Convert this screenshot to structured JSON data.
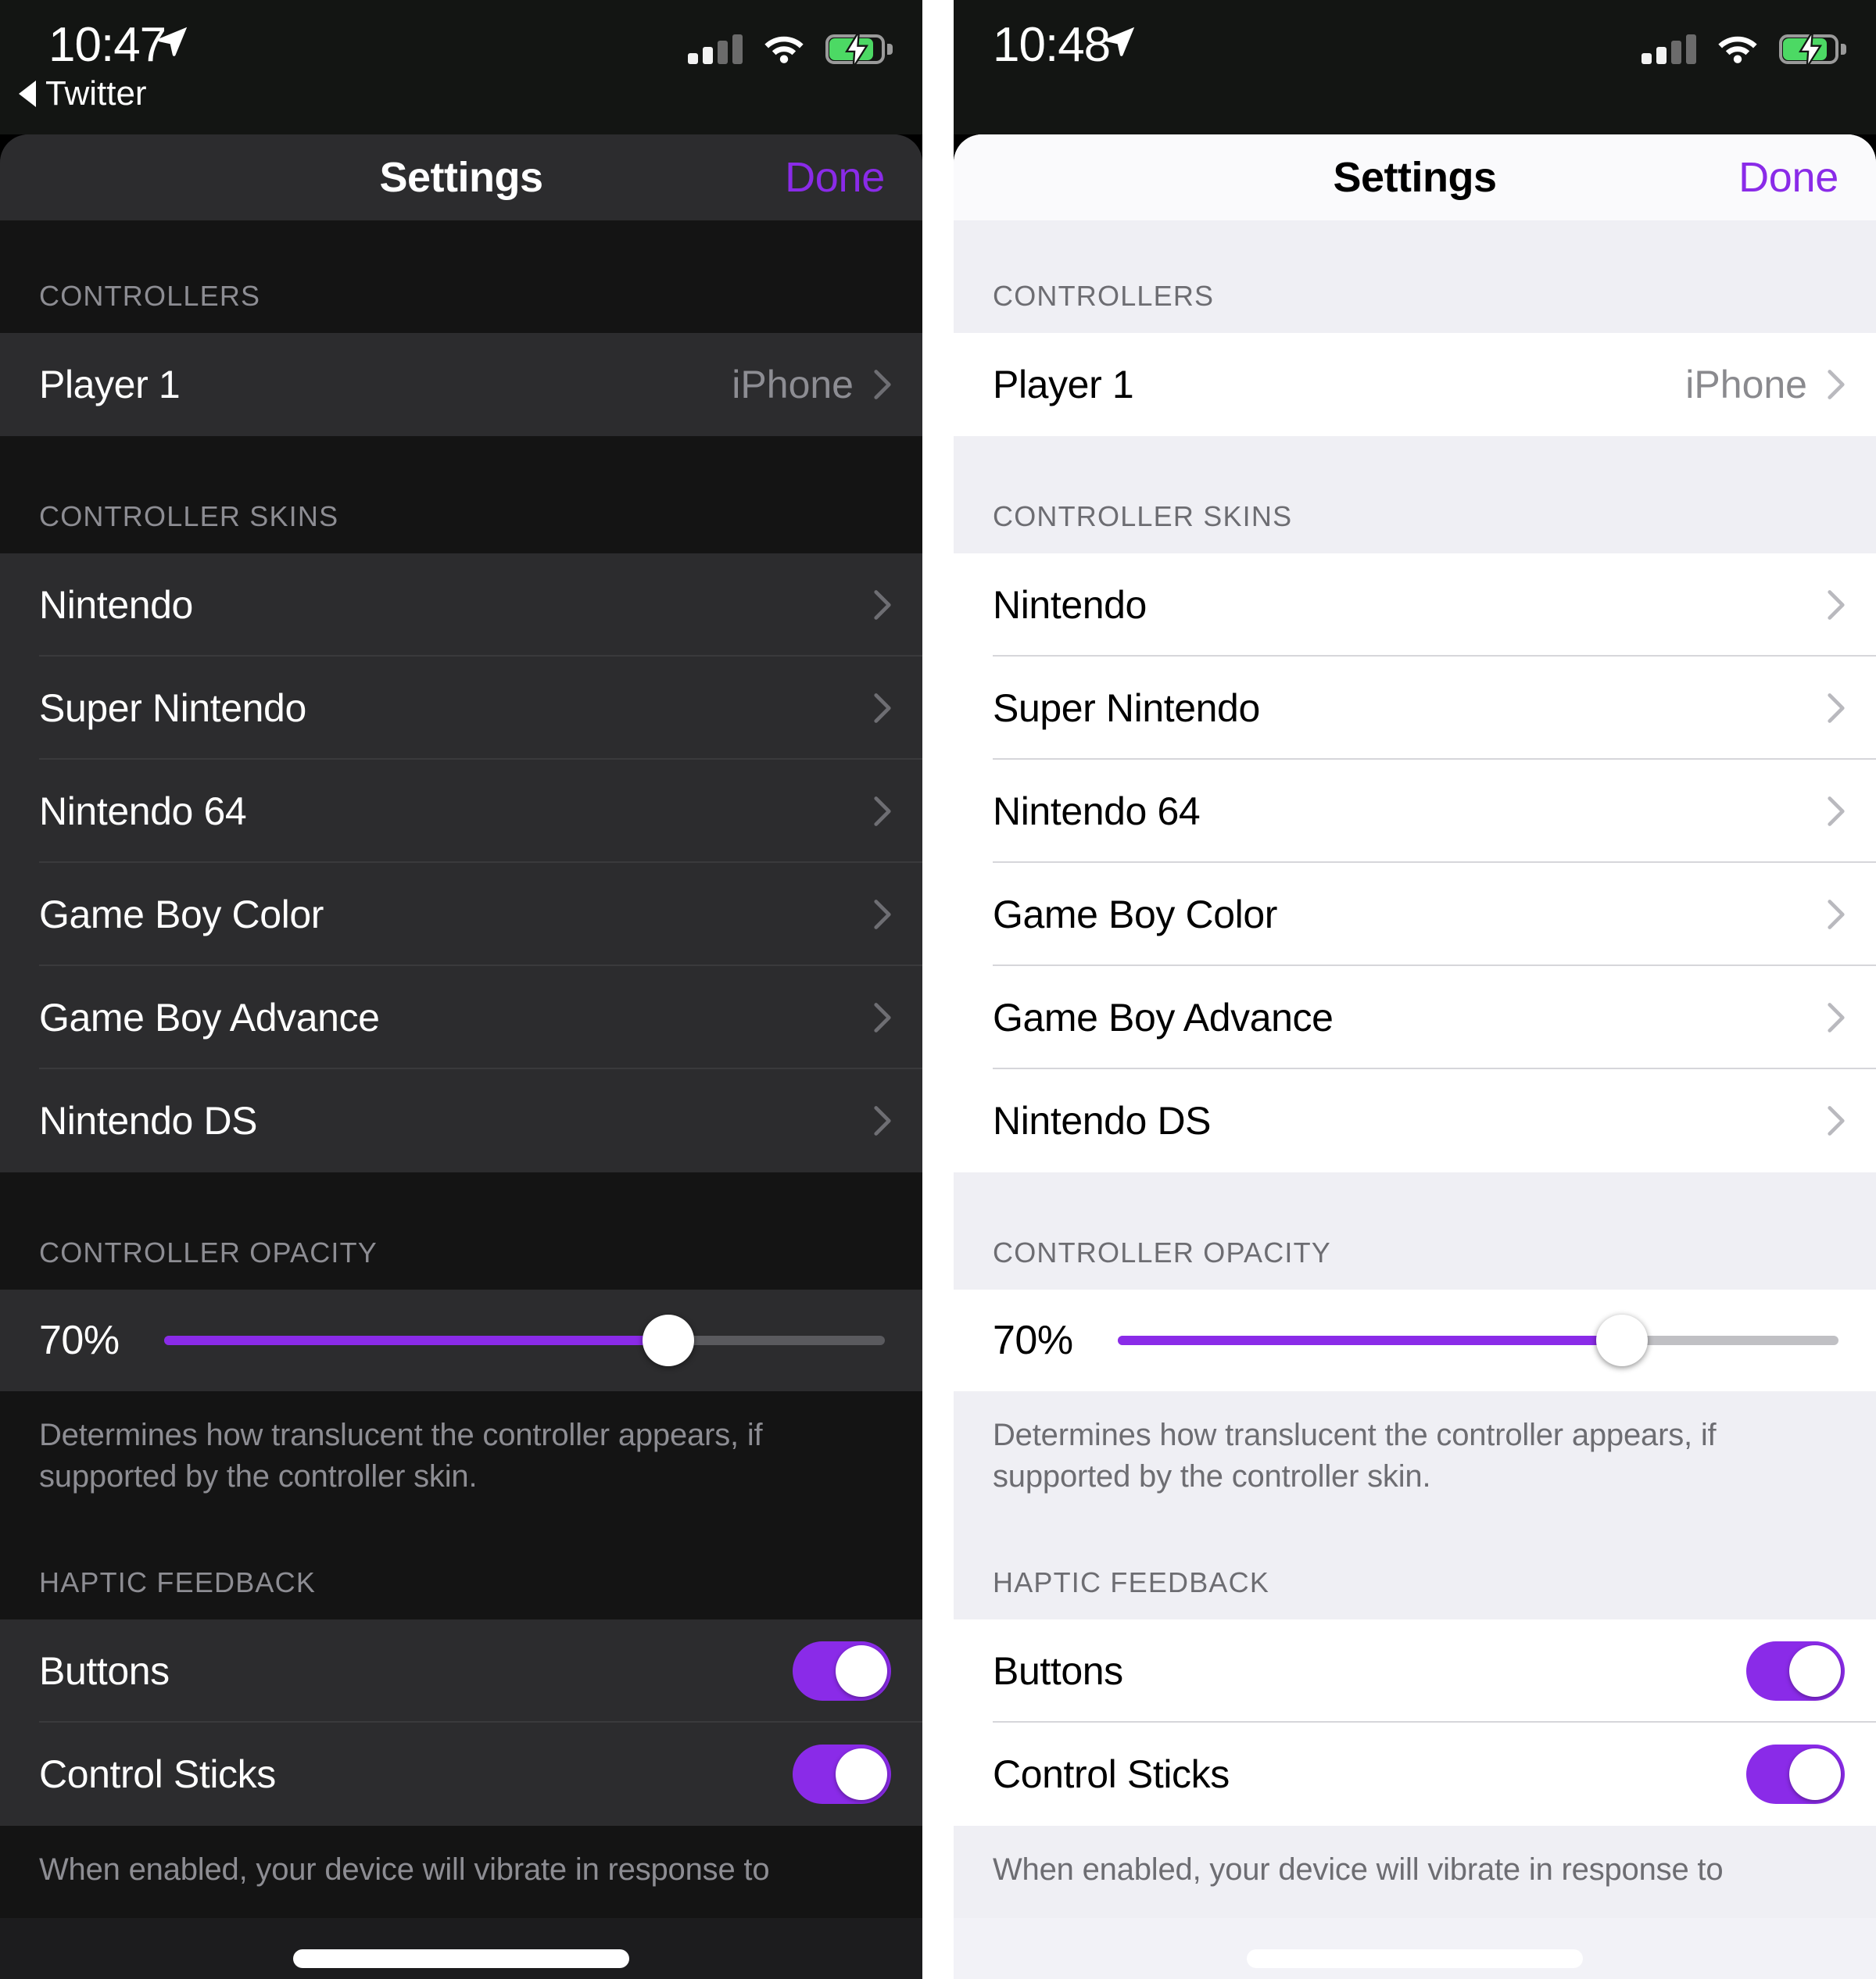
{
  "panels": [
    {
      "id": "dark",
      "theme": "dark",
      "status": {
        "time": "10:47",
        "location_icon": "location-arrow-icon",
        "back_label": "Twitter",
        "signal_icon": "cellular-signal-icon",
        "wifi_icon": "wifi-icon",
        "battery_icon": "battery-charging-icon"
      },
      "nav": {
        "title": "Settings",
        "done_label": "Done"
      },
      "sections": {
        "controllers_header": "CONTROLLERS",
        "player_row": {
          "label": "Player 1",
          "value": "iPhone",
          "chevron": "chevron-right-icon"
        },
        "skins_header": "CONTROLLER SKINS",
        "skins": [
          {
            "label": "Nintendo"
          },
          {
            "label": "Super Nintendo"
          },
          {
            "label": "Nintendo 64"
          },
          {
            "label": "Game Boy Color"
          },
          {
            "label": "Game Boy Advance"
          },
          {
            "label": "Nintendo DS"
          }
        ],
        "opacity_header": "CONTROLLER OPACITY",
        "opacity_value": "70%",
        "opacity_percent": 70,
        "opacity_footnote": "Determines how translucent the controller appears, if supported by the controller skin.",
        "haptic_header": "HAPTIC FEEDBACK",
        "haptics": [
          {
            "label": "Buttons",
            "on": true
          },
          {
            "label": "Control Sticks",
            "on": true
          }
        ],
        "haptic_footnote": "When enabled, your device will vibrate in response to"
      }
    },
    {
      "id": "light",
      "theme": "light",
      "status": {
        "time": "10:48",
        "location_icon": "location-arrow-icon",
        "back_label": "",
        "signal_icon": "cellular-signal-icon",
        "wifi_icon": "wifi-icon",
        "battery_icon": "battery-charging-icon"
      },
      "nav": {
        "title": "Settings",
        "done_label": "Done"
      },
      "sections": {
        "controllers_header": "CONTROLLERS",
        "player_row": {
          "label": "Player 1",
          "value": "iPhone",
          "chevron": "chevron-right-icon"
        },
        "skins_header": "CONTROLLER SKINS",
        "skins": [
          {
            "label": "Nintendo"
          },
          {
            "label": "Super Nintendo"
          },
          {
            "label": "Nintendo 64"
          },
          {
            "label": "Game Boy Color"
          },
          {
            "label": "Game Boy Advance"
          },
          {
            "label": "Nintendo DS"
          }
        ],
        "opacity_header": "CONTROLLER OPACITY",
        "opacity_value": "70%",
        "opacity_percent": 70,
        "opacity_footnote": "Determines how translucent the controller appears, if supported by the controller skin.",
        "haptic_header": "HAPTIC FEEDBACK",
        "haptics": [
          {
            "label": "Buttons",
            "on": true
          },
          {
            "label": "Control Sticks",
            "on": true
          }
        ],
        "haptic_footnote": "When enabled, your device will vibrate in response to"
      }
    }
  ],
  "colors": {
    "accent_purple": "#8A2BE8",
    "battery_green": "#4CD964",
    "dark_group": "#2C2C2E",
    "dark_page": "#141414",
    "light_group": "#FFFFFF",
    "light_page": "#EFEFF4"
  }
}
